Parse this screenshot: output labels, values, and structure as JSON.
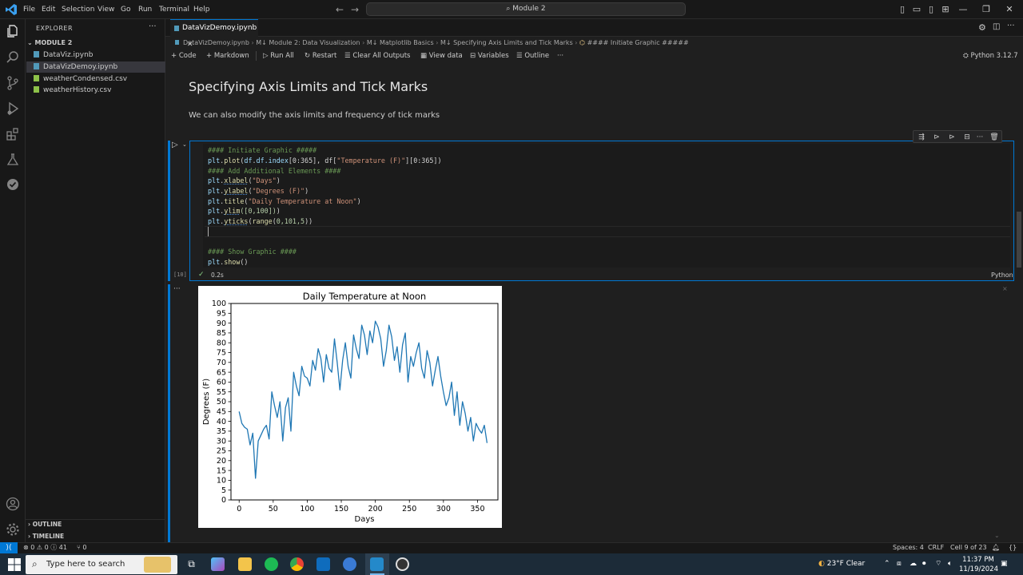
{
  "titlebar": {
    "menu": [
      "File",
      "Edit",
      "Selection",
      "View",
      "Go",
      "Run",
      "Terminal",
      "Help"
    ],
    "command_center": "Module 2"
  },
  "sidebar": {
    "title": "EXPLORER",
    "folder": "MODULE 2",
    "files": [
      {
        "name": "DataViz.ipynb",
        "color": "#519aba"
      },
      {
        "name": "DataVizDemoy.ipynb",
        "color": "#519aba"
      },
      {
        "name": "weatherCondensed.csv",
        "color": "#8dc149"
      },
      {
        "name": "weatherHistory.csv",
        "color": "#8dc149"
      }
    ],
    "outline": "OUTLINE",
    "timeline": "TIMELINE"
  },
  "editor": {
    "tab": "DataVizDemoy.ipynb",
    "breadcrumb": [
      "DataVizDemoy.ipynb",
      "M↓ Module 2: Data Visualization",
      "M↓ Matplotlib Basics",
      "M↓ Specifying Axis Limits and Tick Marks",
      "#### Initiate Graphic #####"
    ],
    "toolbar": {
      "code": "Code",
      "markdown": "Markdown",
      "run_all": "Run All",
      "restart": "Restart",
      "clear_outputs": "Clear All Outputs",
      "view_data": "View data",
      "variables": "Variables",
      "outline": "Outline",
      "more": "···"
    },
    "kernel": "Python 3.12.7"
  },
  "notebook": {
    "heading": "Specifying Axis Limits and Tick Marks",
    "paragraph": "We can also modify the axis limits and frequency of tick marks",
    "cell": {
      "exec_count": "[10]",
      "exec_time": "0.2s",
      "language": "Python"
    },
    "code_text": [
      "#### Initiate Graphic #####",
      "df.index",
      "[0:365], df[",
      "\"Temperature (F)\"",
      "][0:365])",
      "#### Add Additional Elements ####",
      "\"Days\"",
      "\"Degrees (F)\"",
      "\"Daily Temperature at Noon\"",
      "([0,100])",
      "0,101,5",
      "#### Show Graphic ####"
    ]
  },
  "chart_data": {
    "type": "line",
    "title": "Daily Temperature at Noon",
    "xlabel": "Days",
    "ylabel": "Degrees (F)",
    "xlim": [
      -12,
      380
    ],
    "ylim": [
      0,
      100
    ],
    "xticks": [
      0,
      50,
      100,
      150,
      200,
      250,
      300,
      350
    ],
    "yticks": [
      0,
      5,
      10,
      15,
      20,
      25,
      30,
      35,
      40,
      45,
      50,
      55,
      60,
      65,
      70,
      75,
      80,
      85,
      90,
      95,
      100
    ],
    "color": "#1f77b4",
    "x": [
      0,
      4,
      8,
      12,
      16,
      20,
      24,
      28,
      32,
      36,
      40,
      44,
      48,
      52,
      56,
      60,
      64,
      68,
      72,
      76,
      80,
      84,
      88,
      92,
      96,
      100,
      104,
      108,
      112,
      116,
      120,
      124,
      128,
      132,
      136,
      140,
      144,
      148,
      152,
      156,
      160,
      164,
      168,
      172,
      176,
      180,
      184,
      188,
      192,
      196,
      200,
      204,
      208,
      212,
      216,
      220,
      224,
      228,
      232,
      236,
      240,
      244,
      248,
      252,
      256,
      260,
      264,
      268,
      272,
      276,
      280,
      284,
      288,
      292,
      296,
      300,
      304,
      308,
      312,
      316,
      320,
      324,
      328,
      332,
      336,
      340,
      344,
      348,
      352,
      356,
      360,
      364
    ],
    "values": [
      45,
      39,
      37,
      36,
      28,
      34,
      11,
      30,
      33,
      36,
      38,
      31,
      55,
      48,
      42,
      50,
      30,
      47,
      52,
      35,
      65,
      58,
      53,
      68,
      63,
      62,
      58,
      71,
      66,
      77,
      72,
      60,
      74,
      67,
      65,
      82,
      70,
      56,
      71,
      80,
      68,
      62,
      84,
      77,
      72,
      89,
      84,
      74,
      86,
      80,
      91,
      88,
      82,
      68,
      76,
      89,
      83,
      71,
      78,
      65,
      79,
      85,
      60,
      73,
      68,
      75,
      80,
      67,
      62,
      76,
      70,
      58,
      66,
      73,
      63,
      55,
      48,
      52,
      60,
      43,
      55,
      38,
      50,
      44,
      35,
      42,
      30,
      39,
      36,
      34,
      38,
      29
    ]
  },
  "statusbar": {
    "remote": "⟩⟨",
    "problems": "⊗ 0 ⚠ 0 ⓘ 41",
    "ports": "⑂ 0",
    "spaces": "Spaces: 4",
    "eol": "CRLF",
    "cell": "Cell 9 of 23"
  },
  "taskbar": {
    "search": "Type here to search",
    "weather": "23°F  Clear",
    "time": "11:37 PM",
    "date": "11/19/2024"
  }
}
